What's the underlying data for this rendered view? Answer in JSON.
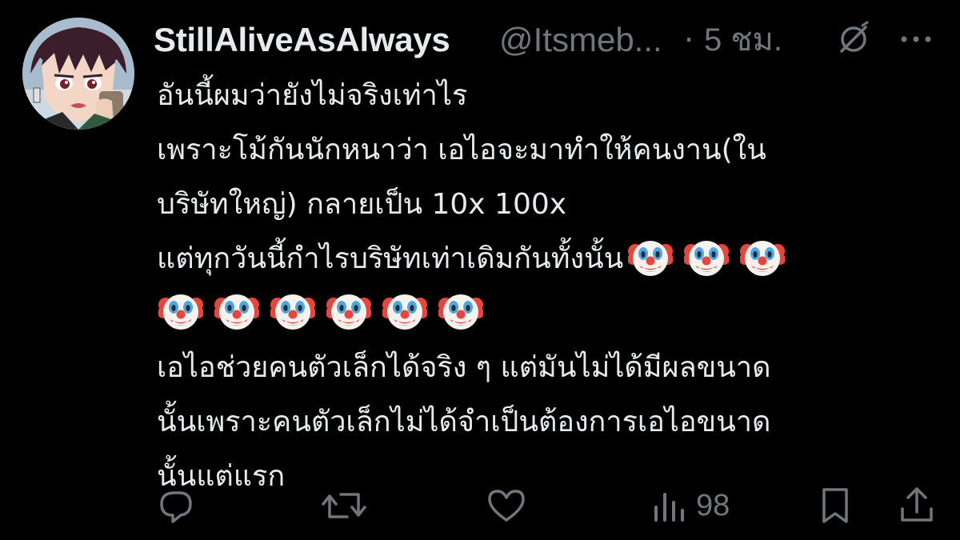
{
  "tweet": {
    "display_name": "StillAliveAsAlways",
    "handle": "@Itsmeb...",
    "separator": "·",
    "time": "5 ชม.",
    "lines": [
      "อันนี้ผมว่ายังไม่จริงเท่าไร",
      "เพราะโม้กันนักหนาว่า เอไอจะมาทำให้คนงาน(ใน",
      "บริษัทใหญ่) กลายเป็น 10x 100x",
      "แต่ทุกวันนี้กำไรบริษัทเท่าเดิมกันทั้งนั้น",
      "",
      "เอไอช่วยคนตัวเล็กได้จริง ๆ แต่มันไม่ได้มีผลขนาด",
      "นั้นเพราะคนตัวเล็กไม่ได้จำเป็นต้องการเอไอขนาด",
      "นั้นแต่แรก"
    ],
    "emoji_counts": {
      "line4": 3,
      "line5": 6
    },
    "emoji_name": "clown-face"
  },
  "actions": {
    "views": "98",
    "icons": [
      "reply-icon",
      "retweet-icon",
      "like-icon",
      "views-icon",
      "bookmark-icon",
      "share-icon"
    ]
  },
  "colors": {
    "background": "#000000",
    "text": "#e7e9ea",
    "secondary": "#71767b"
  }
}
